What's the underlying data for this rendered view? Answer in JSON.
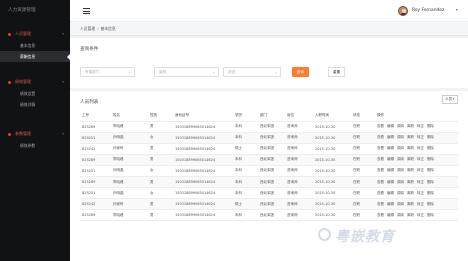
{
  "app": {
    "brand": "人力资源管理"
  },
  "sidebar": {
    "groups": [
      {
        "label": "人员管理",
        "caret": "▾",
        "items": [
          {
            "label": "基本信息"
          },
          {
            "label": "薪酬信息"
          }
        ]
      },
      {
        "label": "绩效管理",
        "caret": "▾",
        "items": [
          {
            "label": "绩效设置"
          },
          {
            "label": "绩效详情"
          }
        ]
      },
      {
        "label": "参数管理",
        "caret": "▾",
        "items": [
          {
            "label": "绩效参数"
          }
        ]
      }
    ]
  },
  "header": {
    "user_name": "Roy Fernandez",
    "user_caret": "▾"
  },
  "breadcrumb": {
    "items": [
      "人员管理",
      "基本信息"
    ],
    "sep": "/"
  },
  "query": {
    "title": "查询条件",
    "selects": [
      {
        "placeholder": "所属部门",
        "caret": "⌄"
      },
      {
        "placeholder": "级别",
        "caret": "⌄"
      },
      {
        "placeholder": "状态",
        "caret": "⌄"
      }
    ],
    "search_label": "查询",
    "reset_label": "重置"
  },
  "list": {
    "title": "人员列表",
    "add_label": "人员+",
    "columns": [
      "工号",
      "姓名",
      "性别",
      "身份证号",
      "学历",
      "部门",
      "岗位",
      "入职时间",
      "状态",
      "操作"
    ],
    "rows": [
      [
        "825269",
        "李晓峰",
        "男",
        "150318899065014624",
        "本科",
        "西北军团",
        "咨询师",
        "2015-10-30",
        "在职"
      ],
      [
        "825251",
        "孙响晶",
        "女",
        "150318899065014624",
        "本科",
        "西北军团",
        "咨询师",
        "2015-10-30",
        "在职"
      ],
      [
        "825242",
        "孙家轩",
        "男",
        "150318899065014624",
        "硕士",
        "西北军团",
        "咨询师",
        "2015-10-30",
        "在职"
      ],
      [
        "825289",
        "李晓峰",
        "男",
        "150318899065014624",
        "本科",
        "西北军团",
        "咨询师",
        "2015-10-30",
        "在职"
      ],
      [
        "825251",
        "孙响晶",
        "女",
        "150318899065014624",
        "本科",
        "西北军团",
        "咨询师",
        "2015-10-30",
        "在职"
      ],
      [
        "825269",
        "李晓峰",
        "男",
        "150318899065014624",
        "本科",
        "西北军团",
        "咨询师",
        "2015-10-30",
        "在职"
      ],
      [
        "825251",
        "孙响晶",
        "女",
        "150318899065014624",
        "本科",
        "西北军团",
        "咨询师",
        "2015-10-30",
        "在职"
      ],
      [
        "825242",
        "孙家轩",
        "男",
        "150318899065014624",
        "硕士",
        "西北军团",
        "咨询师",
        "2015-10-30",
        "在职"
      ],
      [
        "825289",
        "李晓峰",
        "男",
        "150318899065014624",
        "本科",
        "西北军团",
        "咨询师",
        "2015-10-30",
        "在职"
      ]
    ],
    "actions": [
      "查看",
      "编辑",
      "调岗",
      "离职",
      "转正",
      "删除"
    ]
  },
  "watermark": {
    "text": "粤嵌教育"
  },
  "colors": {
    "accent": "#ff7b2e",
    "sidebar_bg": "#111214",
    "group_accent": "#e25b45"
  }
}
